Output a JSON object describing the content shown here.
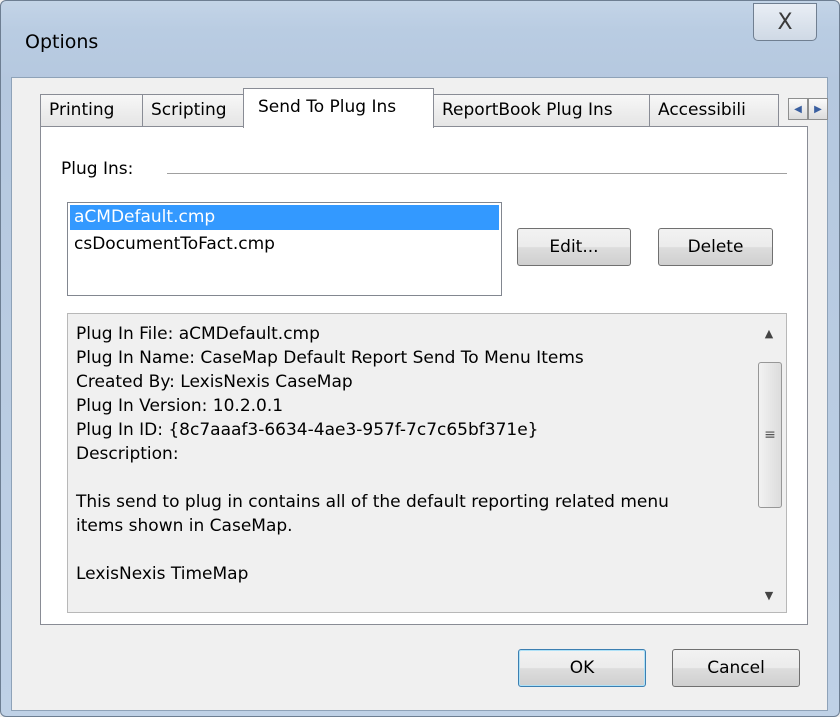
{
  "window": {
    "title": "Options",
    "close_glyph": "X"
  },
  "tabs": [
    {
      "label": "Printing"
    },
    {
      "label": "Scripting"
    },
    {
      "label": "Send To Plug Ins"
    },
    {
      "label": "ReportBook Plug Ins"
    },
    {
      "label": "Accessibili"
    }
  ],
  "active_tab": "Send To Plug Ins",
  "plugins": {
    "group_label": "Plug Ins:",
    "items": [
      {
        "label": "aCMDefault.cmp",
        "selected": true
      },
      {
        "label": "csDocumentToFact.cmp",
        "selected": false
      }
    ],
    "edit_label": "Edit...",
    "delete_label": "Delete"
  },
  "details": {
    "lines": [
      "Plug In File: aCMDefault.cmp",
      "Plug In Name: CaseMap Default Report Send To Menu Items",
      "Created By: LexisNexis CaseMap",
      "Plug In Version: 10.2.0.1",
      "Plug In ID: {8c7aaaf3-6634-4ae3-957f-7c7c65bf371e}",
      "Description:",
      "",
      "This send to plug in contains all of the default reporting related menu",
      "items shown in CaseMap.",
      "",
      "LexisNexis TimeMap"
    ]
  },
  "footer": {
    "ok_label": "OK",
    "cancel_label": "Cancel"
  },
  "icons": {
    "close": "close-icon",
    "tab_left": "chevron-left-icon",
    "tab_right": "chevron-right-icon",
    "scroll_up": "scroll-up-icon",
    "scroll_down": "scroll-down-icon"
  },
  "colors": {
    "selection": "#3399ff",
    "title_bar": "#b9cce2"
  }
}
